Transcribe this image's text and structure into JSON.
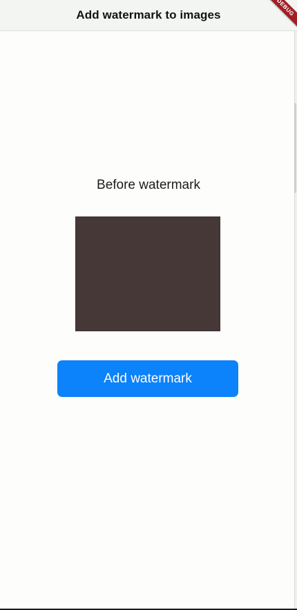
{
  "app_bar": {
    "title": "Add watermark to images"
  },
  "debug_banner": {
    "label": "DEBUG"
  },
  "main": {
    "caption": "Before watermark",
    "image_color": "#453836",
    "button_label": "Add watermark"
  },
  "colors": {
    "accent": "#0c82fb",
    "background": "#fdfefb",
    "banner": "#a01f25"
  }
}
